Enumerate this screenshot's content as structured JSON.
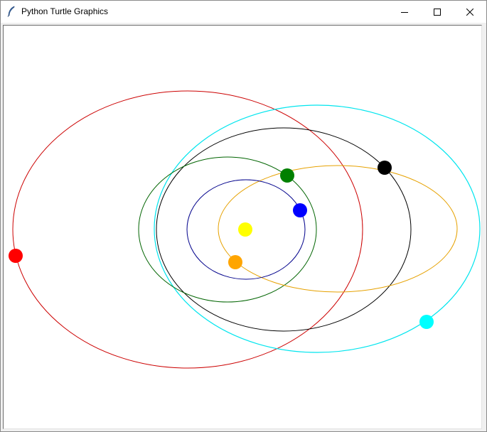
{
  "window": {
    "title": "Python Turtle Graphics",
    "icons": {
      "app": "feather-icon",
      "minimize": "minimize-icon",
      "maximize": "maximize-icon",
      "close": "close-icon"
    }
  },
  "canvas": {
    "background": "#ffffff",
    "orbits": [
      {
        "name": "orbit-red",
        "color": "#cc0000"
      },
      {
        "name": "orbit-cyan",
        "color": "#00e5ee"
      },
      {
        "name": "orbit-black",
        "color": "#000000"
      },
      {
        "name": "orbit-green",
        "color": "#006400"
      },
      {
        "name": "orbit-orange",
        "color": "#e6a100"
      },
      {
        "name": "orbit-blue",
        "color": "#00008b"
      }
    ],
    "bodies": [
      {
        "name": "sun",
        "color": "#ffff00"
      },
      {
        "name": "planet-red",
        "color": "#ff0000"
      },
      {
        "name": "planet-cyan",
        "color": "#00ffff"
      },
      {
        "name": "planet-black",
        "color": "#000000"
      },
      {
        "name": "planet-green",
        "color": "#008000"
      },
      {
        "name": "planet-blue",
        "color": "#0000ff"
      },
      {
        "name": "planet-orange",
        "color": "#ffa500"
      }
    ]
  }
}
